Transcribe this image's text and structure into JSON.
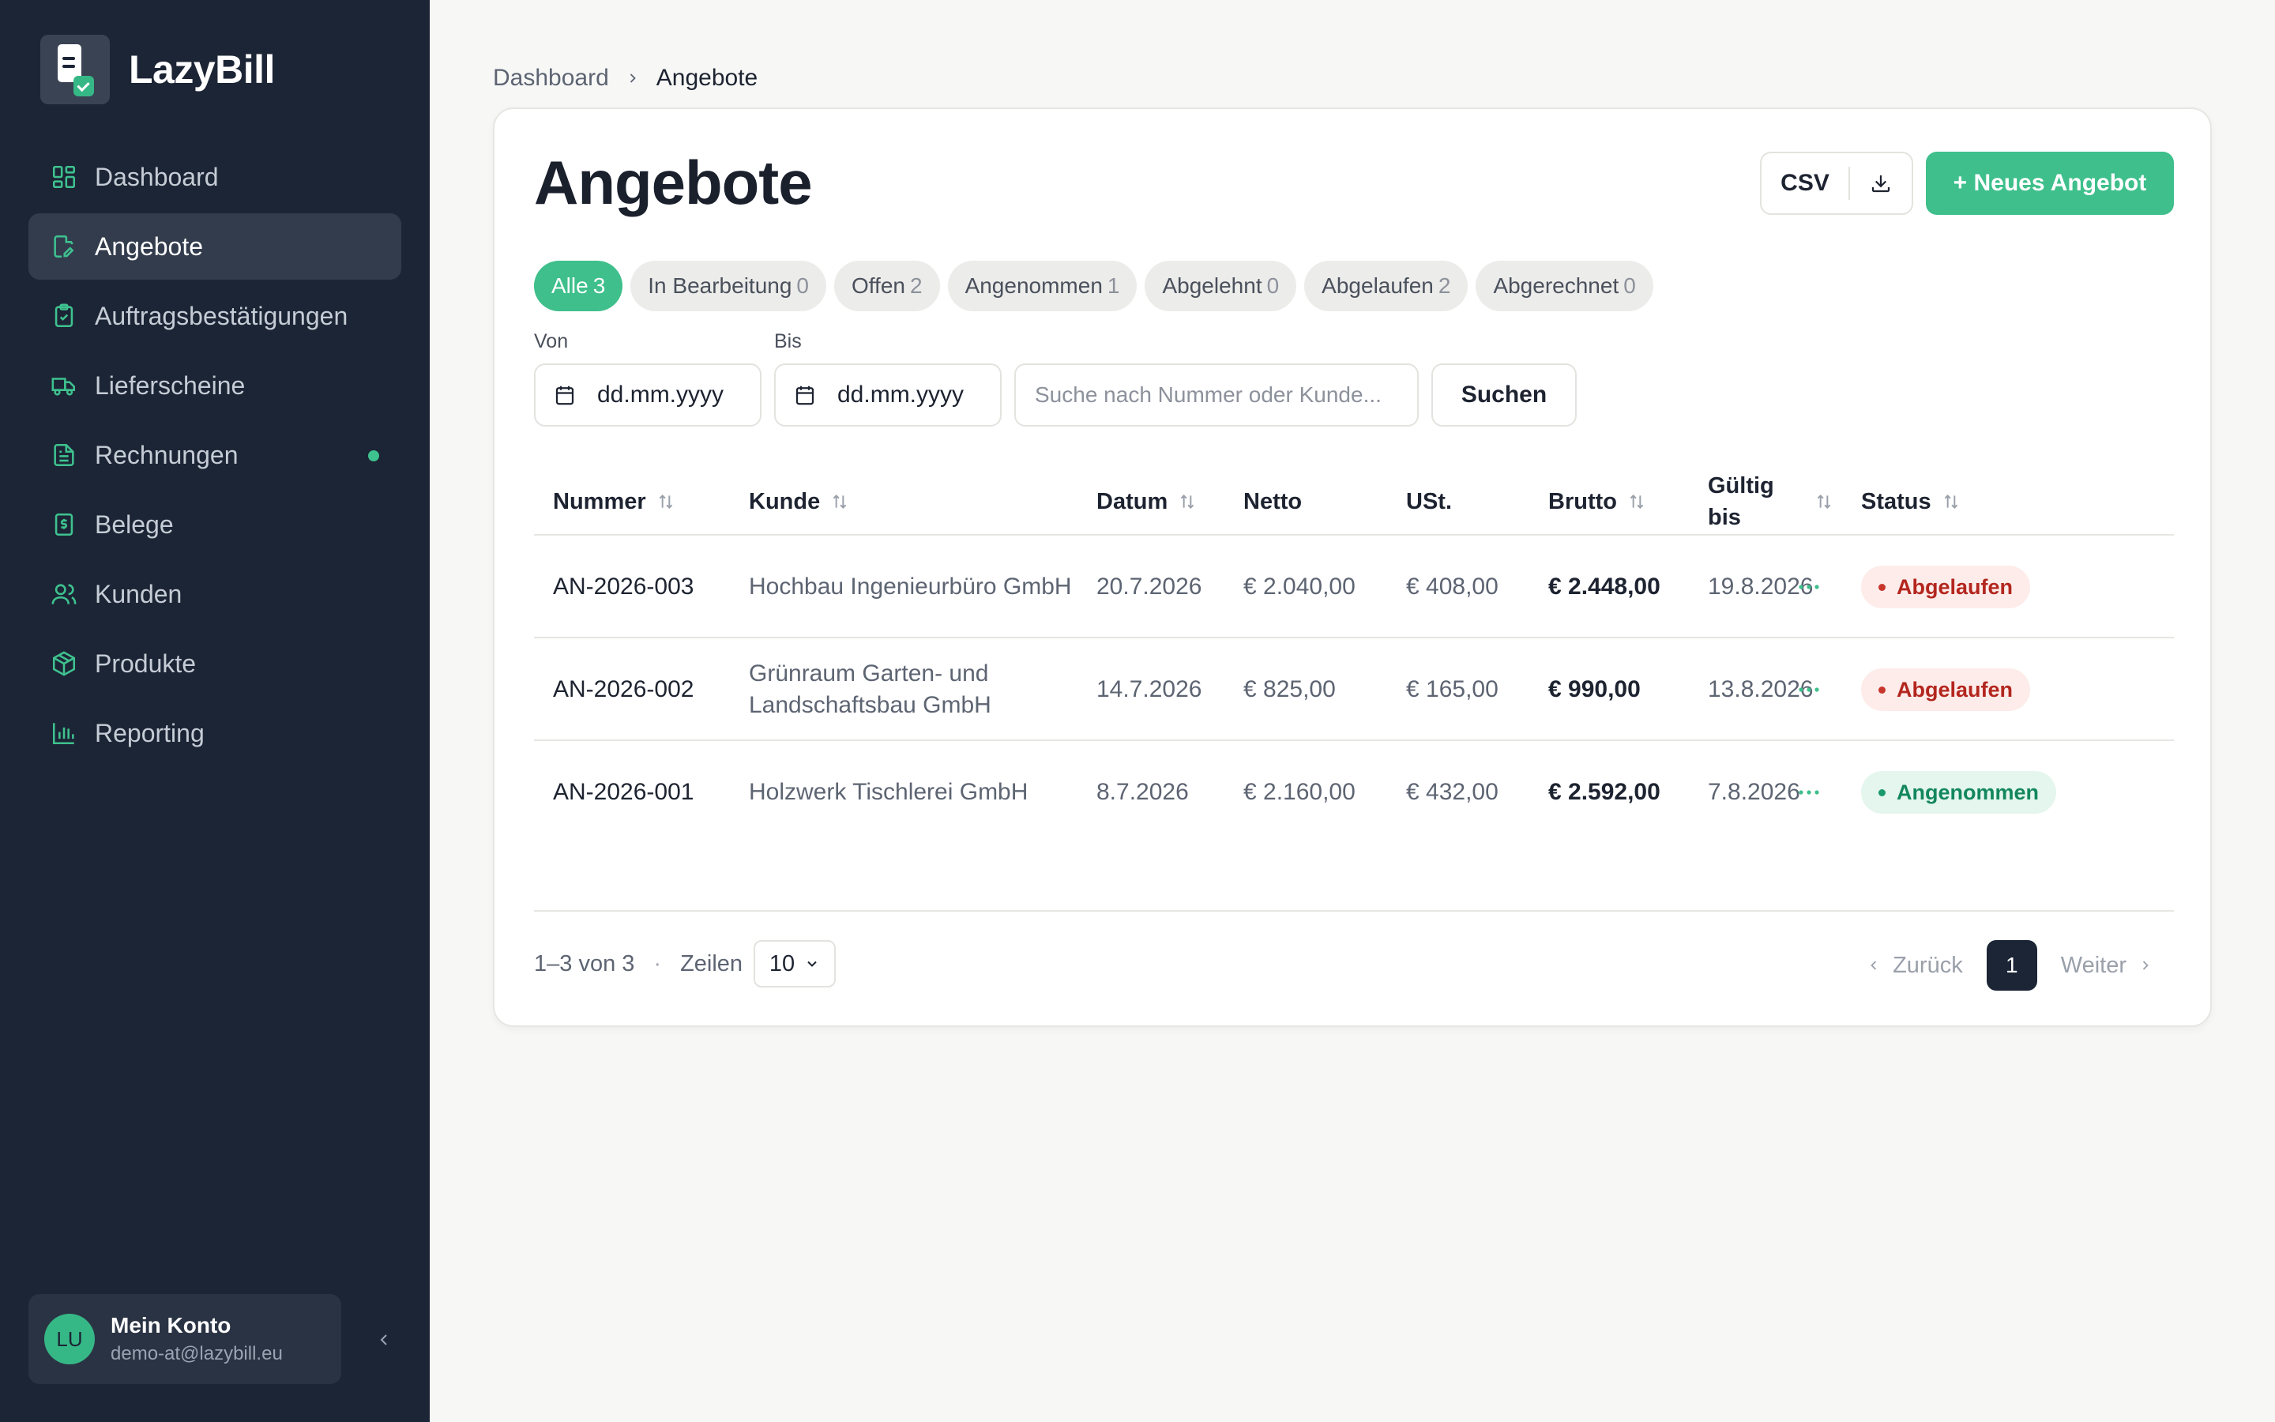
{
  "app": {
    "name": "LazyBill"
  },
  "sidebar": {
    "items": [
      {
        "label": "Dashboard",
        "icon": "dashboard-icon"
      },
      {
        "label": "Angebote",
        "icon": "file-edit-icon",
        "active": true
      },
      {
        "label": "Auftragsbestätigungen",
        "icon": "clipboard-check-icon"
      },
      {
        "label": "Lieferscheine",
        "icon": "truck-icon"
      },
      {
        "label": "Rechnungen",
        "icon": "file-text-icon",
        "badge_dot": true
      },
      {
        "label": "Belege",
        "icon": "receipt-icon"
      },
      {
        "label": "Kunden",
        "icon": "users-icon"
      },
      {
        "label": "Produkte",
        "icon": "package-icon"
      },
      {
        "label": "Reporting",
        "icon": "bar-chart-icon"
      }
    ],
    "account": {
      "initials": "LU",
      "name": "Mein Konto",
      "email": "demo-at@lazybill.eu"
    }
  },
  "breadcrumb": {
    "root": "Dashboard",
    "current": "Angebote"
  },
  "page": {
    "title": "Angebote",
    "csv_label": "CSV",
    "new_button": "+ Neues Angebot"
  },
  "tabs": [
    {
      "label": "Alle",
      "count": "3",
      "active": true
    },
    {
      "label": "In Bearbeitung",
      "count": "0"
    },
    {
      "label": "Offen",
      "count": "2"
    },
    {
      "label": "Angenommen",
      "count": "1"
    },
    {
      "label": "Abgelehnt",
      "count": "0"
    },
    {
      "label": "Abgelaufen",
      "count": "2"
    },
    {
      "label": "Abgerechnet",
      "count": "0"
    }
  ],
  "filters": {
    "from_label": "Von",
    "to_label": "Bis",
    "from_value": "dd.mm.yyyy",
    "to_value": "dd.mm.yyyy",
    "search_placeholder": "Suche nach Nummer oder Kunde...",
    "search_button": "Suchen"
  },
  "table": {
    "headers": {
      "nummer": "Nummer",
      "kunde": "Kunde",
      "datum": "Datum",
      "netto": "Netto",
      "ust": "USt.",
      "brutto": "Brutto",
      "gueltig_1": "Gültig",
      "gueltig_2": "bis",
      "status": "Status"
    },
    "rows": [
      {
        "nummer": "AN-2026-003",
        "kunde": "Hochbau Ingenieurbüro GmbH",
        "datum": "20.7.2026",
        "netto": "€ 2.040,00",
        "ust": "€ 408,00",
        "brutto": "€ 2.448,00",
        "gueltig": "19.8.2026",
        "status": "Abgelaufen",
        "status_type": "expired"
      },
      {
        "nummer": "AN-2026-002",
        "kunde": "Grünraum Garten- und Landschaftsbau GmbH",
        "datum": "14.7.2026",
        "netto": "€ 825,00",
        "ust": "€ 165,00",
        "brutto": "€ 990,00",
        "gueltig": "13.8.2026",
        "status": "Abgelaufen",
        "status_type": "expired"
      },
      {
        "nummer": "AN-2026-001",
        "kunde": "Holzwerk Tischlerei GmbH",
        "datum": "8.7.2026",
        "netto": "€ 2.160,00",
        "ust": "€ 432,00",
        "brutto": "€ 2.592,00",
        "gueltig": "7.8.2026",
        "status": "Angenommen",
        "status_type": "accepted"
      }
    ]
  },
  "footer": {
    "range": "1–3 von 3",
    "rows_label": "Zeilen",
    "rows_value": "10",
    "prev": "Zurück",
    "next": "Weiter",
    "current_page": "1"
  },
  "colors": {
    "sidebar": "#1c2535",
    "accent": "#3ebf8b",
    "expired": "#b3261e",
    "accepted": "#13875e"
  }
}
